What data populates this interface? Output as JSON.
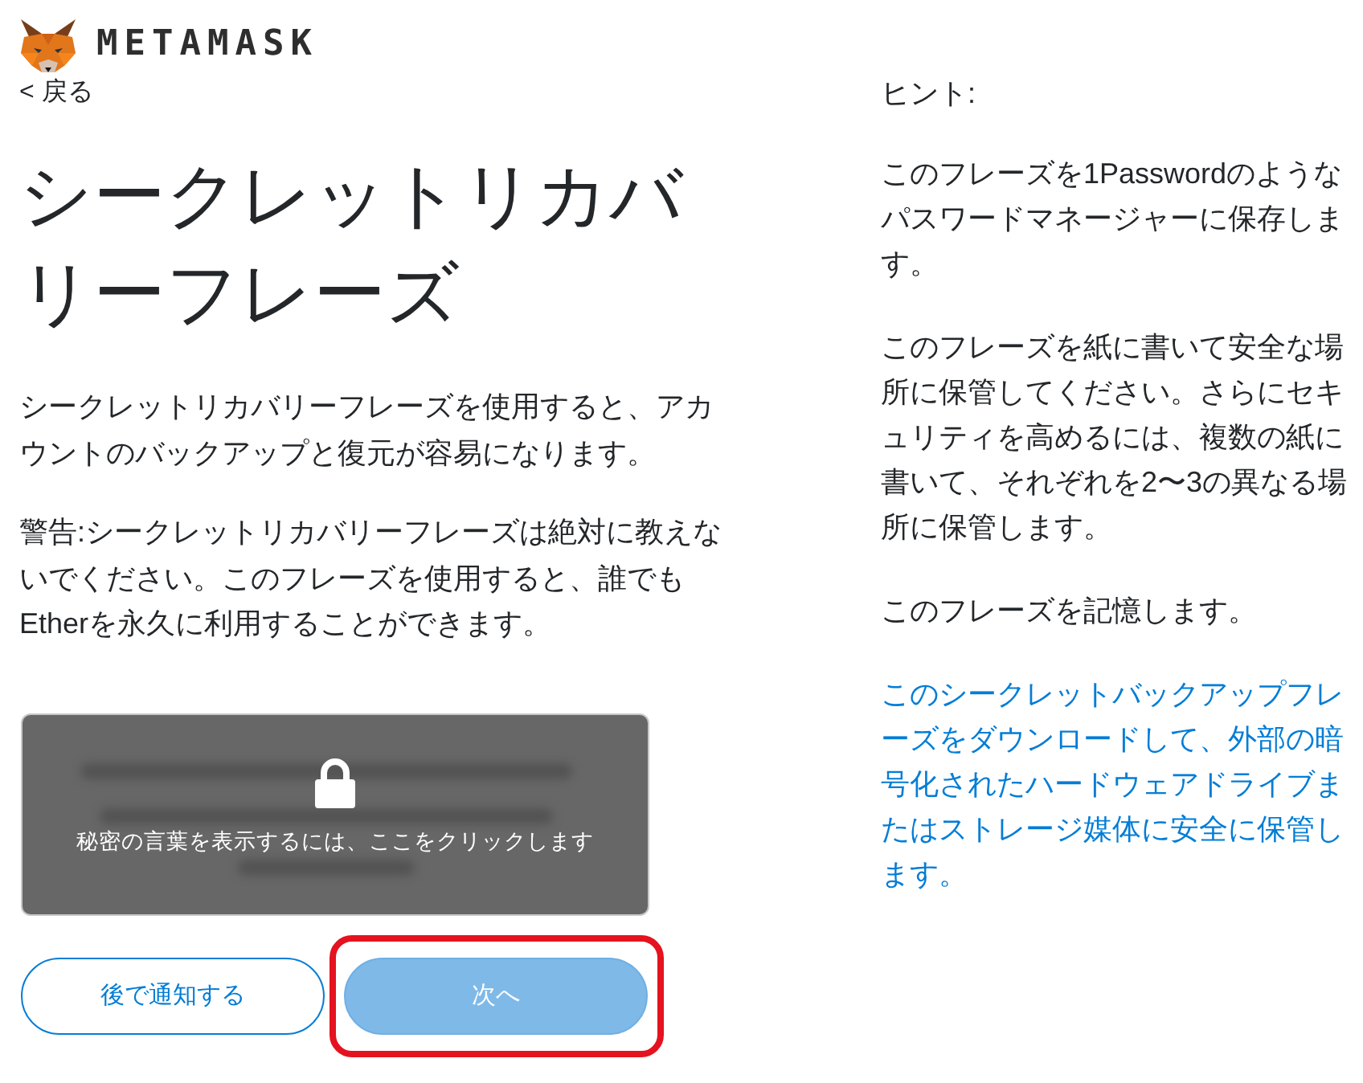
{
  "header": {
    "logo_text": "METAMASK"
  },
  "back_link": "< 戻る",
  "title": "シークレットリカバリーフレーズ",
  "description": [
    "シークレットリカバリーフレーズを使用すると、アカウントのバックアップと復元が容易になります。",
    "警告:シークレットリカバリーフレーズは絶対に教えないでください。このフレーズを使用すると、誰でもEtherを永久に利用することができます。"
  ],
  "reveal": {
    "prompt": "秘密の言葉を表示するには、ここをクリックします"
  },
  "buttons": [
    {
      "label": "後で通知する",
      "kind": "secondary",
      "disabled": false,
      "highlighted": false
    },
    {
      "label": "次へ",
      "kind": "primary",
      "disabled": true,
      "highlighted": true
    }
  ],
  "tips": {
    "heading": "ヒント:",
    "items": [
      {
        "kind": "text",
        "text": "このフレーズを1Passwordのようなパスワードマネージャーに保存します。"
      },
      {
        "kind": "text",
        "text": "このフレーズを紙に書いて安全な場所に保管してください。さらにセキュリティを高めるには、複数の紙に書いて、それぞれを2〜3の異なる場所に保管します。"
      },
      {
        "kind": "text",
        "text": "このフレーズを記憶します。"
      },
      {
        "kind": "link",
        "text": "このシークレットバックアップフレーズをダウンロードして、外部の暗号化されたハードウェアドライブまたはストレージ媒体に安全に保管します。"
      }
    ]
  }
}
